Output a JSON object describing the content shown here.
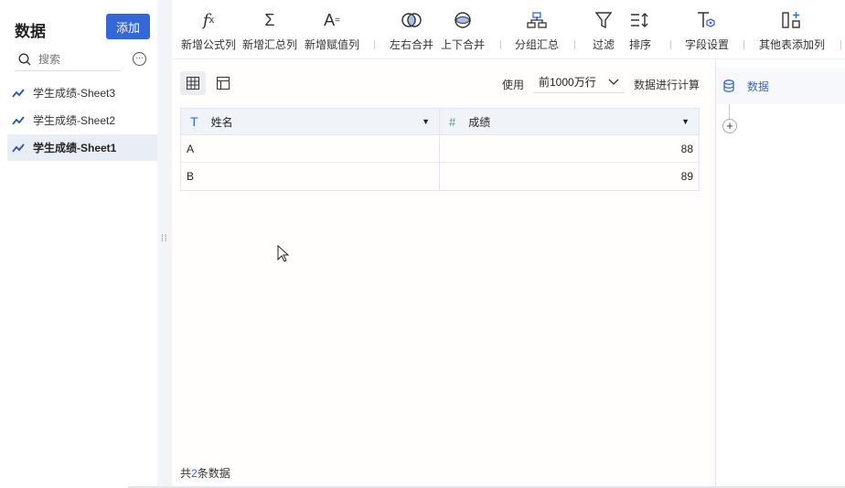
{
  "sidebar": {
    "title": "数据",
    "add_label": "添加",
    "search_placeholder": "搜索",
    "more": "···",
    "items": [
      {
        "label": "学生成绩-Sheet3"
      },
      {
        "label": "学生成绩-Sheet2"
      },
      {
        "label": "学生成绩-Sheet1",
        "active": true
      }
    ]
  },
  "toolbar": {
    "items": [
      {
        "label": "新增公式列",
        "icon": "function-icon"
      },
      {
        "label": "新增汇总列",
        "icon": "sigma-icon"
      },
      {
        "label": "新增赋值列",
        "icon": "assign-icon"
      },
      {
        "label": "左右合并",
        "icon": "merge-horizontal-icon"
      },
      {
        "label": "上下合并",
        "icon": "merge-vertical-icon"
      },
      {
        "label": "分组汇总",
        "icon": "group-icon"
      },
      {
        "label": "过滤",
        "icon": "filter-icon"
      },
      {
        "label": "排序",
        "icon": "sort-icon"
      },
      {
        "label": "字段设置",
        "icon": "field-settings-icon"
      },
      {
        "label": "其他表添加列",
        "icon": "add-column-icon"
      }
    ]
  },
  "main": {
    "use_label": "使用",
    "rows_option": "前1000万行",
    "calc_label": "数据进行计算",
    "columns": [
      {
        "name": "姓名",
        "type": "text"
      },
      {
        "name": "成绩",
        "type": "number"
      }
    ],
    "rows": [
      [
        "A",
        "88"
      ],
      [
        "B",
        "89"
      ]
    ],
    "footer": {
      "prefix": "共",
      "count": "2",
      "suffix": "条数据"
    }
  },
  "right_panel": {
    "node_label": "数据"
  },
  "colors": {
    "accent": "#3667d6"
  }
}
